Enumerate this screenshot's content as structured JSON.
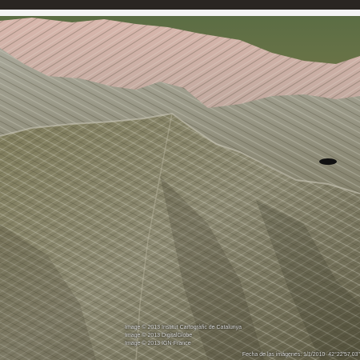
{
  "credits": [
    "Image © 2013 Institut Cartogràfic de Catalunya",
    "Image © 2013 DigitalGlobe",
    "Image © 2013 IGN-France"
  ],
  "status": {
    "imagery_date": "Fecha de las imágenes: 1/1/2010",
    "latitude": "42°22'57.03\""
  }
}
